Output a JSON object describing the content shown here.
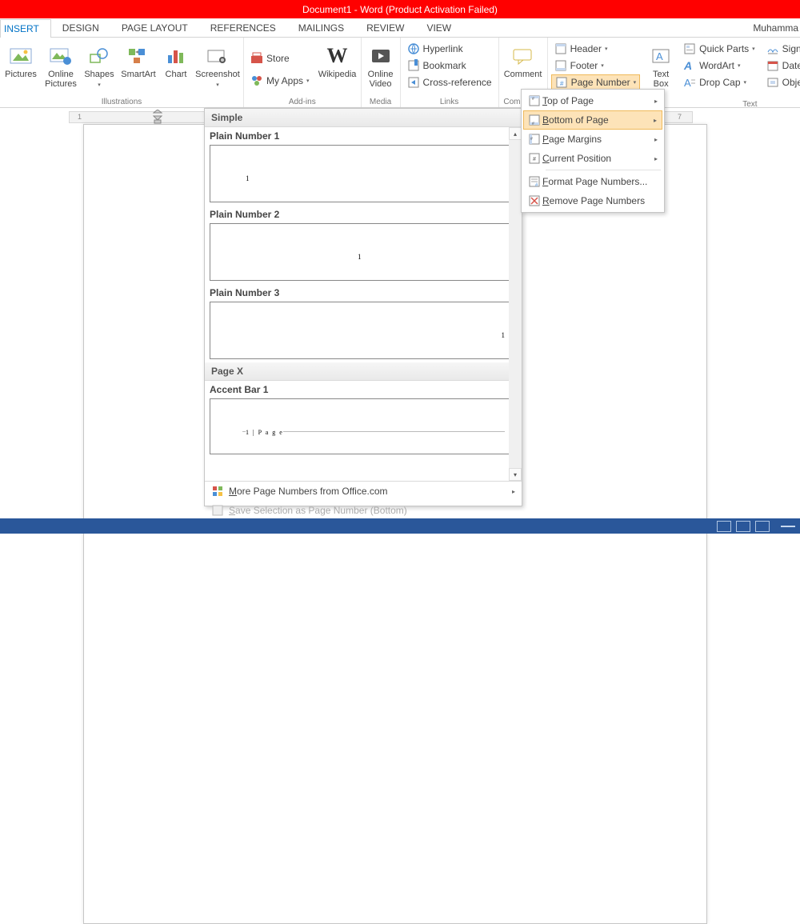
{
  "title": "Document1 - Word (Product Activation Failed)",
  "user": "Muhamma",
  "tabs": [
    "INSERT",
    "DESIGN",
    "PAGE LAYOUT",
    "REFERENCES",
    "MAILINGS",
    "REVIEW",
    "VIEW"
  ],
  "active_tab": 0,
  "ribbon": {
    "illustrations": {
      "label": "Illustrations",
      "pictures": "Pictures",
      "online_pictures": "Online Pictures",
      "shapes": "Shapes",
      "smartart": "SmartArt",
      "chart": "Chart",
      "screenshot": "Screenshot"
    },
    "addins": {
      "label": "Add-ins",
      "store": "Store",
      "my_apps": "My Apps",
      "wikipedia": "Wikipedia"
    },
    "media": {
      "label": "Media",
      "online_video": "Online Video"
    },
    "links": {
      "label": "Links",
      "hyperlink": "Hyperlink",
      "bookmark": "Bookmark",
      "crossref": "Cross-reference"
    },
    "comments": {
      "label": "Comments",
      "comment": "Comment"
    },
    "header_footer": {
      "header": "Header",
      "footer": "Footer",
      "page_number": "Page Number"
    },
    "text": {
      "label": "Text",
      "text_box": "Text Box",
      "quick_parts": "Quick Parts",
      "wordart": "WordArt",
      "drop_cap": "Drop Cap",
      "signature_line": "Signature Line",
      "date_time": "Date & Time",
      "object": "Object"
    }
  },
  "ruler": {
    "n1": "1",
    "n7": "7"
  },
  "page_number_menu": {
    "top": "Top of Page",
    "bottom": "Bottom of Page",
    "margins": "Page Margins",
    "current": "Current Position",
    "format": "Format Page Numbers...",
    "remove": "Remove Page Numbers"
  },
  "gallery": {
    "section_simple": "Simple",
    "plain1": "Plain Number 1",
    "plain2": "Plain Number 2",
    "plain3": "Plain Number 3",
    "section_pagex": "Page X",
    "accent1": "Accent Bar 1",
    "accent_sample": "1 | P a g e",
    "sample_num": "1",
    "more": "More Page Numbers from Office.com",
    "save": "Save Selection as Page Number (Bottom)"
  }
}
